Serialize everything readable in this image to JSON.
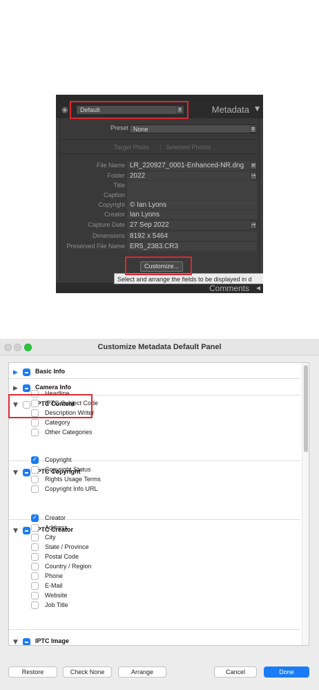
{
  "lightroom": {
    "panel_preset_value": "Default",
    "panel_title": "Metadata",
    "preset_label": "Preset",
    "preset_value": "None",
    "tab_target": "Target Photo",
    "tab_selected": "Selected Photos",
    "fields": [
      {
        "label": "File Name",
        "value": "LR_220927_0001-Enhanced-NR.dng",
        "has_button": true
      },
      {
        "label": "Folder",
        "value": "2022",
        "has_button": true
      },
      {
        "label": "Title",
        "value": "",
        "has_button": false
      },
      {
        "label": "Caption",
        "value": "",
        "has_button": false
      },
      {
        "label": "Copyright",
        "value": "© Ian Lyons",
        "has_button": false
      },
      {
        "label": "Creator",
        "value": "Ian Lyons",
        "has_button": false
      },
      {
        "label": "Capture Date",
        "value": "27 Sep 2022",
        "has_button": true
      },
      {
        "label": "Dimensions",
        "value": "8192 x 5464",
        "has_button": false
      },
      {
        "label": "Preserved File Name",
        "value": "ER5_2383.CR3",
        "has_button": false
      }
    ],
    "customize_label": "Customize...",
    "tooltip": "Select and arrange the fields to be displayed in d",
    "comments_label": "Comments"
  },
  "dialog": {
    "title": "Customize Metadata Default Panel",
    "groups": [
      {
        "name": "Basic Info",
        "expanded": false,
        "state": "mixed",
        "items": []
      },
      {
        "name": "Camera Info",
        "expanded": false,
        "state": "mixed",
        "items": []
      },
      {
        "name": "IPTC Content",
        "expanded": true,
        "state": "unchecked",
        "items": [
          {
            "label": "Headline",
            "checked": false
          },
          {
            "label": "IPTC Subject Code",
            "checked": false
          },
          {
            "label": "Description Writer",
            "checked": false
          },
          {
            "label": "Category",
            "checked": false
          },
          {
            "label": "Other Categories",
            "checked": false
          }
        ]
      },
      {
        "name": "IPTC Copyright",
        "expanded": true,
        "state": "mixed",
        "items": [
          {
            "label": "Copyright",
            "checked": true
          },
          {
            "label": "Copyright Status",
            "checked": false
          },
          {
            "label": "Rights Usage Terms",
            "checked": false
          },
          {
            "label": "Copyright Info URL",
            "checked": false
          }
        ]
      },
      {
        "name": "IPTC Creator",
        "expanded": true,
        "state": "mixed",
        "items": [
          {
            "label": "Creator",
            "checked": true
          },
          {
            "label": "Address",
            "checked": false
          },
          {
            "label": "City",
            "checked": false
          },
          {
            "label": "State / Province",
            "checked": false
          },
          {
            "label": "Postal Code",
            "checked": false
          },
          {
            "label": "Country / Region",
            "checked": false
          },
          {
            "label": "Phone",
            "checked": false
          },
          {
            "label": "E-Mail",
            "checked": false
          },
          {
            "label": "Website",
            "checked": false
          },
          {
            "label": "Job Title",
            "checked": false
          }
        ]
      },
      {
        "name": "IPTC Image",
        "expanded": true,
        "state": "mixed",
        "items": []
      }
    ],
    "buttons": {
      "restore": "Restore",
      "check_none": "Check None",
      "arrange": "Arrange",
      "cancel": "Cancel",
      "done": "Done"
    }
  },
  "icons": {
    "eye": "eye-icon",
    "disclosure_collapsed": "disclosure-right-icon",
    "disclosure_expanded": "disclosure-down-icon",
    "checkmark": "checkmark-icon"
  },
  "colors": {
    "accent": "#1a7cf4",
    "highlight_box": "#e3262f",
    "close": "#ff5f57",
    "minimize": "#febc2e",
    "zoom": "#28c840"
  }
}
